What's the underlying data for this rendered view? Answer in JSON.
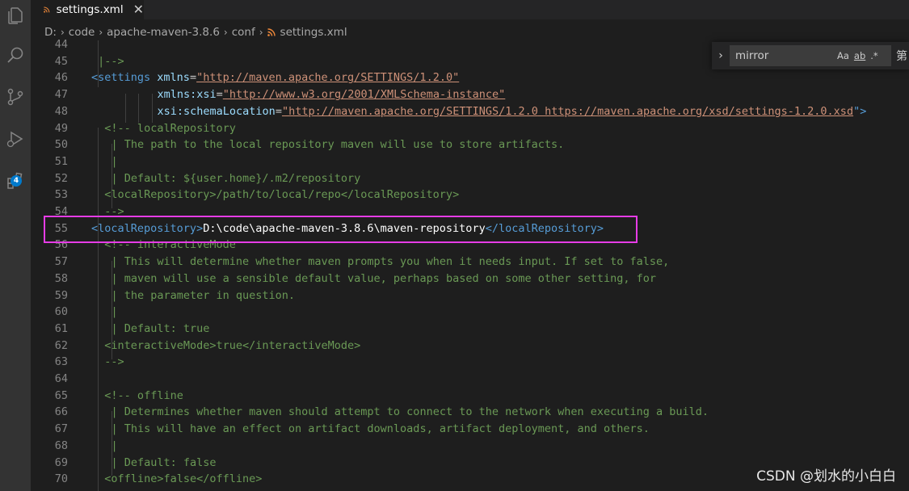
{
  "tab": {
    "label": "settings.xml",
    "close": "✕"
  },
  "breadcrumb": {
    "drive": "D:",
    "code": "code",
    "maven": "apache-maven-3.8.6",
    "conf": "conf",
    "file": "settings.xml"
  },
  "find": {
    "query": "mirror",
    "case_label": "Aa",
    "word_label": "ab",
    "regex_label": ".*",
    "overflow": "第"
  },
  "activity": {
    "extensions_badge": "4"
  },
  "lines": [
    {
      "n": "44",
      "t": ""
    },
    {
      "n": "45",
      "t": "|-->"
    },
    {
      "n": "46",
      "a": "<",
      "b": "settings",
      "c": " xmlns",
      "d": "=",
      "e": "\"http://maven.apache.org/SETTINGS/1.2.0\""
    },
    {
      "n": "47",
      "c": "xmlns:xsi",
      "d": "=",
      "e": "\"http://www.w3.org/2001/XMLSchema-instance\""
    },
    {
      "n": "48",
      "c": "xsi:schemaLocation",
      "d": "=",
      "e": "\"http://maven.apache.org/SETTINGS/1.2.0",
      "f": " https://maven.apache.org/xsd/settings-1.2.0.xsd",
      "g": "\">"
    },
    {
      "n": "49",
      "t": "<!-- localRepository"
    },
    {
      "n": "50",
      "t": "| The path to the local repository maven will use to store artifacts."
    },
    {
      "n": "51",
      "t": "|"
    },
    {
      "n": "52",
      "t": "| Default: ${user.home}/.m2/repository"
    },
    {
      "n": "53",
      "t": "<localRepository>/path/to/local/repo</localRepository>"
    },
    {
      "n": "54",
      "t": "-->"
    },
    {
      "n": "55",
      "a": "<",
      "b": "localRepository",
      "g": ">",
      "h": "D:\\code\\apache-maven-3.8.6\\maven-repository",
      "i": "</",
      "j": "localRepository",
      "k": ">"
    },
    {
      "n": "56",
      "t": "<!-- interactiveMode"
    },
    {
      "n": "57",
      "t": "| This will determine whether maven prompts you when it needs input. If set to false,"
    },
    {
      "n": "58",
      "t": "| maven will use a sensible default value, perhaps based on some other setting, for"
    },
    {
      "n": "59",
      "t": "| the parameter in question."
    },
    {
      "n": "60",
      "t": "|"
    },
    {
      "n": "61",
      "t": "| Default: true"
    },
    {
      "n": "62",
      "t": "<interactiveMode>true</interactiveMode>"
    },
    {
      "n": "63",
      "t": "-->"
    },
    {
      "n": "64",
      "t": ""
    },
    {
      "n": "65",
      "t": "<!-- offline"
    },
    {
      "n": "66",
      "t": "| Determines whether maven should attempt to connect to the network when executing a build."
    },
    {
      "n": "67",
      "t": "| This will have an effect on artifact downloads, artifact deployment, and others."
    },
    {
      "n": "68",
      "t": "|"
    },
    {
      "n": "69",
      "t": "| Default: false"
    },
    {
      "n": "70",
      "t": "<offline>false</offline>"
    }
  ],
  "watermark": "CSDN @划水的小白白",
  "colors": {
    "comment": "#6a9955",
    "tag": "#569cd6",
    "attr": "#9cdcfe",
    "string": "#ce9178",
    "highlight": "#e63ce6",
    "accent": "#007acc"
  }
}
